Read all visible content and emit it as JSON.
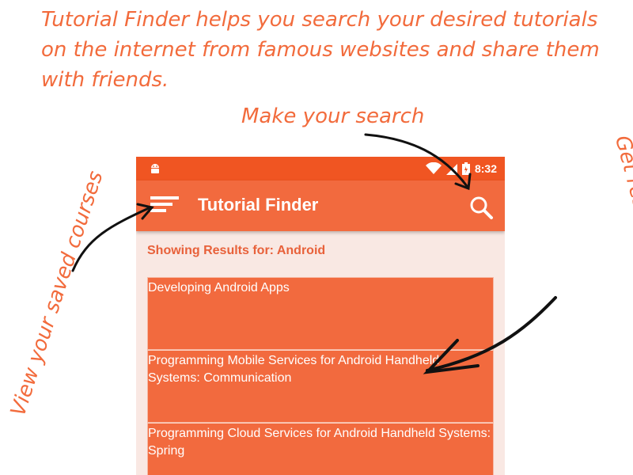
{
  "annotations": {
    "headline": "Tutorial Finder helps you search your desired tutorials on the internet from famous websites and share them with friends.",
    "make_search": "Make your search",
    "view_saved": "View your saved courses",
    "get_results": "Get results and suggestions"
  },
  "status_bar": {
    "time": "8:32",
    "icons": [
      "android-icon",
      "wifi-icon",
      "signal-icon",
      "battery-icon"
    ]
  },
  "app_bar": {
    "title": "Tutorial Finder",
    "menu_icon": "menu-icon",
    "search_icon": "search-icon"
  },
  "main": {
    "results_label": "Showing Results for: Android",
    "results": [
      "Developing Android Apps",
      "Programming Mobile Services for Android Handheld Systems: Communication",
      "Programming Cloud Services for Android Handheld Systems: Spring"
    ]
  },
  "colors": {
    "accent": "#f26a3e",
    "status_bar": "#f05522",
    "annotation": "#f26b3c",
    "background": "#f9e8e3"
  }
}
